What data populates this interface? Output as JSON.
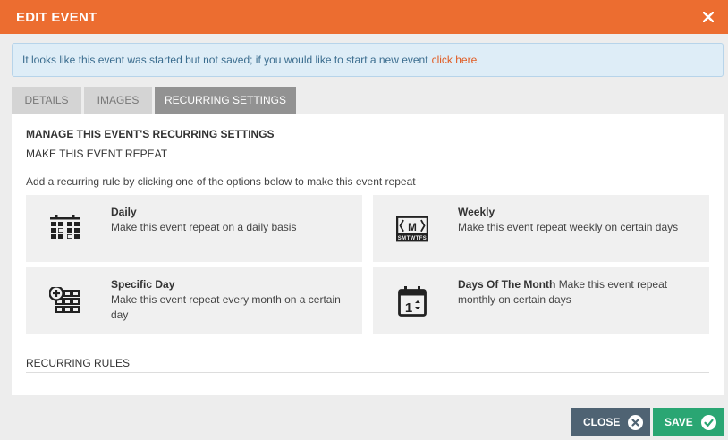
{
  "header": {
    "title": "EDIT EVENT",
    "close_icon": "close-icon"
  },
  "notice": {
    "text": "It looks like this event was started but not saved; if you would like to start a new event",
    "link": "click here"
  },
  "tabs": [
    {
      "label": "DETAILS",
      "active": false
    },
    {
      "label": "IMAGES",
      "active": false
    },
    {
      "label": "RECURRING SETTINGS",
      "active": true
    }
  ],
  "panel": {
    "heading": "MANAGE THIS EVENT'S RECURRING SETTINGS",
    "subheading": "MAKE THIS EVENT REPEAT",
    "intro": "Add a recurring rule by clicking one of the options below to make this event repeat",
    "options": [
      {
        "title": "Daily",
        "desc": "Make this event repeat on a daily basis",
        "icon": "calendar-grid-icon"
      },
      {
        "title": "Weekly",
        "desc": "Make this event repeat weekly on certain days",
        "icon": "weekly-icon"
      },
      {
        "title": "Specific Day",
        "desc": "Make this event repeat every month on a certain day",
        "icon": "specific-day-icon"
      },
      {
        "title": "Days Of The Month",
        "desc": "Make this event repeat monthly on certain days",
        "icon": "days-of-month-icon"
      }
    ],
    "rules_heading": "RECURRING RULES"
  },
  "footer": {
    "close_label": "CLOSE",
    "save_label": "SAVE"
  },
  "colors": {
    "header": "#ec6d30",
    "close_button": "#4f6373",
    "save_button": "#2aa673",
    "link": "#e15b22"
  }
}
